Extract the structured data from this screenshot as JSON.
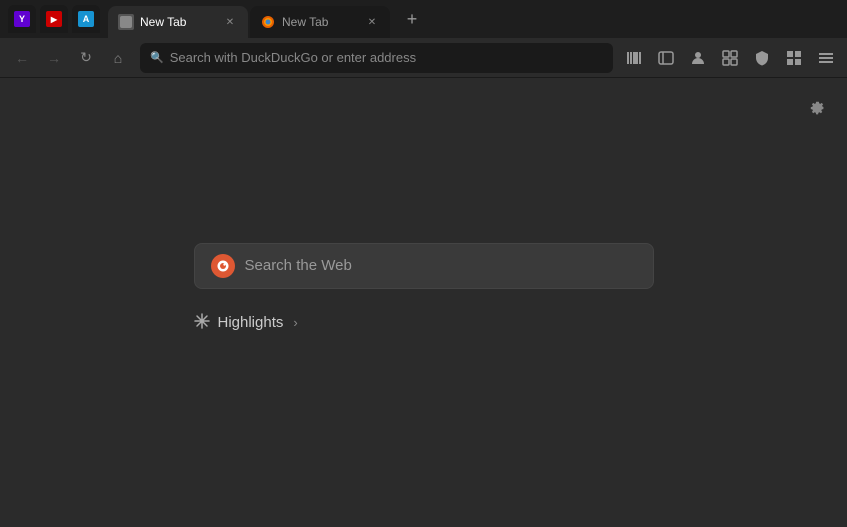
{
  "titlebar": {
    "pinned_tabs": [
      {
        "id": "yahoo",
        "label": "Y",
        "favicon_class": "yahoo"
      },
      {
        "id": "yts",
        "label": "▶",
        "favicon_class": "yts"
      },
      {
        "id": "arch",
        "label": "A",
        "favicon_class": "arch"
      }
    ],
    "tabs": [
      {
        "id": "tab1",
        "label": "New Tab",
        "active": true,
        "favicon": "newtab"
      },
      {
        "id": "tab2",
        "label": "New Tab",
        "active": false,
        "favicon": "firefox"
      }
    ],
    "new_tab_label": "+"
  },
  "navbar": {
    "back_label": "←",
    "forward_label": "→",
    "reload_label": "↻",
    "home_label": "⌂",
    "address_placeholder": "Search with DuckDuckGo or enter address",
    "toolbar_icons": [
      "library",
      "sidebar",
      "account",
      "customize",
      "shield",
      "grid",
      "menu"
    ]
  },
  "main": {
    "settings_label": "⚙",
    "search_placeholder": "Search the Web",
    "highlights_label": "Highlights",
    "highlights_chevron": "›"
  },
  "colors": {
    "background": "#2b2b2b",
    "titlebar_bg": "#1e1e1e",
    "address_bg": "#1a1a1a",
    "search_bg": "#3a3a3a",
    "tab_active_bg": "#2b2b2b",
    "tab_inactive_bg": "#1a1a1a"
  }
}
